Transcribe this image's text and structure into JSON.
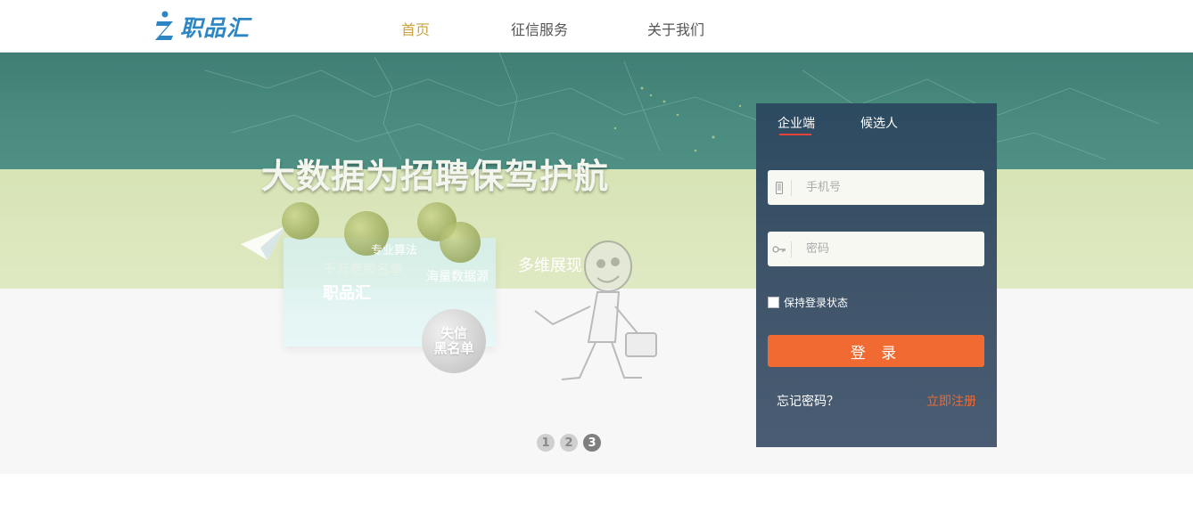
{
  "header": {
    "logo_text": "职品汇",
    "nav": [
      {
        "label": "首页",
        "active": true
      },
      {
        "label": "征信服务",
        "active": false
      },
      {
        "label": "关于我们",
        "active": false
      }
    ]
  },
  "banner": {
    "headline": "大数据为招聘保驾护航",
    "labels": {
      "algorithm": "专业算法",
      "blacklist_names": "千万老赖名单",
      "data_source": "海量数据源",
      "multi_display": "多维展现",
      "brand": "职品汇"
    },
    "ball_text": [
      "失信",
      "黑名单"
    ],
    "slides": [
      "1",
      "2",
      "3"
    ],
    "active_slide": 3
  },
  "login": {
    "tabs": [
      {
        "label": "企业端",
        "active": true
      },
      {
        "label": "候选人",
        "active": false
      }
    ],
    "phone_placeholder": "手机号",
    "password_placeholder": "密码",
    "remember_label": "保持登录状态",
    "login_button": "登 录",
    "forgot_link": "忘记密码？",
    "register_link": "立即注册"
  },
  "colors": {
    "accent_orange": "#f06a32",
    "nav_active": "#c9a23c",
    "panel": "#3d5368",
    "logo_blue": "#2d86c4"
  }
}
